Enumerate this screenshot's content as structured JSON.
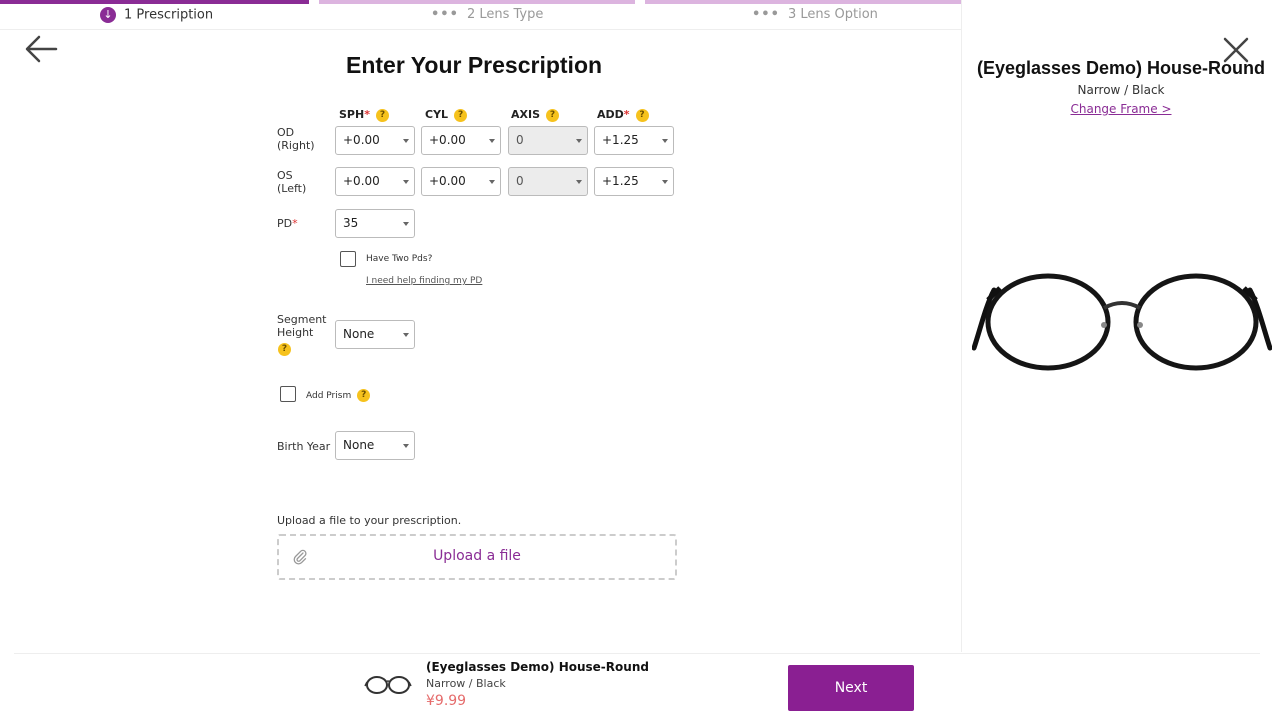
{
  "steps": [
    {
      "number_label": "1 Prescription",
      "state": "current"
    },
    {
      "number_label": "2 Lens Type",
      "state": "upcoming"
    },
    {
      "number_label": "3 Lens Option",
      "state": "upcoming"
    }
  ],
  "page_title": "Enter Your Prescription",
  "columns": {
    "sph": "SPH",
    "cyl": "CYL",
    "axis": "AXIS",
    "add": "ADD",
    "required_mark": "*",
    "help_glyph": "?"
  },
  "rows": {
    "od": {
      "label_line1": "OD",
      "label_line2": "(Right)",
      "sph": "+0.00",
      "cyl": "+0.00",
      "axis": "0",
      "add": "+1.25"
    },
    "os": {
      "label_line1": "OS",
      "label_line2": "(Left)",
      "sph": "+0.00",
      "cyl": "+0.00",
      "axis": "0",
      "add": "+1.25"
    }
  },
  "pd": {
    "label": "PD",
    "value": "35",
    "two_pds_label": "Have Two Pds?",
    "help_link": "I need help finding my PD"
  },
  "segment_height": {
    "label_line1": "Segment",
    "label_line2": "Height",
    "value": "None"
  },
  "prism": {
    "label": "Add Prism"
  },
  "birth_year": {
    "label": "Birth Year",
    "value": "None"
  },
  "upload": {
    "label": "Upload a file to your prescription.",
    "button": "Upload a file"
  },
  "bottom_bar": {
    "product_name": "(Eyeglasses Demo) House-Round",
    "variant": "Narrow / Black",
    "price": "¥9.99",
    "next_label": "Next"
  },
  "product_panel": {
    "name": "(Eyeglasses Demo) House-Round",
    "variant": "Narrow / Black",
    "change_frame": "Change Frame >"
  },
  "colors": {
    "accent": "#8a2c95",
    "price": "#e56b6b",
    "help": "#f6c21d"
  }
}
